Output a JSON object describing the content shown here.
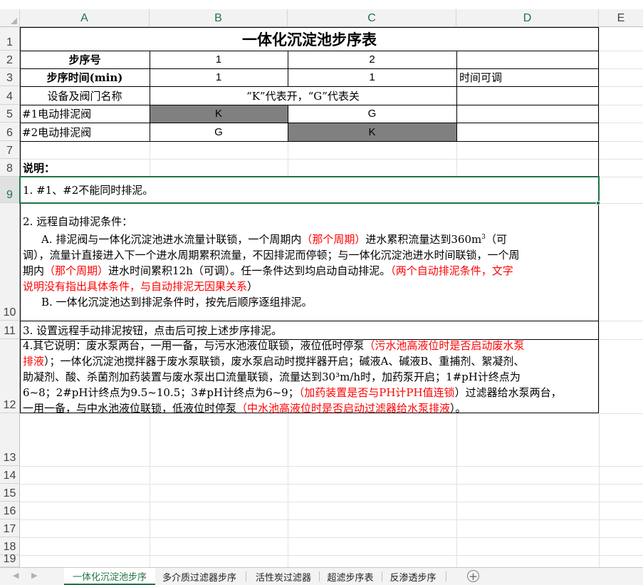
{
  "columns": [
    "A",
    "B",
    "C",
    "D",
    "E"
  ],
  "rows": [
    "1",
    "2",
    "3",
    "4",
    "5",
    "6",
    "7",
    "8",
    "9",
    "10",
    "11",
    "12",
    "13",
    "14",
    "15",
    "16",
    "17",
    "18",
    "19"
  ],
  "selected_row": "9",
  "sheet": {
    "title": "一体化沉淀池步序表",
    "row2": {
      "label": "步序号",
      "b": "1",
      "c": "2"
    },
    "row3": {
      "label": "步序时间(min)",
      "b": "1",
      "c": "1",
      "d": "时间可调"
    },
    "row4": {
      "label": "设备及阀门名称",
      "bc": "“K”代表开，“G”代表关"
    },
    "row5": {
      "label": "#1电动排泥阀",
      "b": "K",
      "c": "G"
    },
    "row6": {
      "label": "#2电动排泥阀",
      "b": "G",
      "c": "K"
    },
    "row8": {
      "label": "说明："
    },
    "row9": {
      "text": "1. #1、#2不能同时排泥。"
    },
    "row10": {
      "l1": "2. 远程自动排泥条件：",
      "l2_a": "A. 排泥阀与一体化沉淀池进水流量计联锁，一个周期内",
      "l2_r": "（那个周期）",
      "l2_b": "进水累积流量达到360m",
      "l2_sup": "3",
      "l2_c": "（可",
      "l3": "调），流量计直接进入下一个进水周期累积流量，不因排泥而停顿；与一体化沉淀池进水时间联锁，一个周",
      "l4_a": "期内",
      "l4_r1": "（那个周期）",
      "l4_b": "进水时间累积12h（可调）。任一条件达到均启动自动排泥。",
      "l4_r2": "（两个自动排泥条件，文字",
      "l5_r": "说明没有指出具体条件，与自动排泥无因果关系",
      "l5_b": "）",
      "l6": "B. 一体化沉淀池达到排泥条件时，按先后顺序逐组排泥。"
    },
    "row11": {
      "text": "3. 设置远程手动排泥按钮，点击后可按上述步序排泥。"
    },
    "row12": {
      "l1_a": "4.其它说明：废水泵两台，一用一备，与污水池液位联锁，液位低时停泵",
      "l1_r": "（污水池高液位时是否启动废水泵",
      "l2_r": "排液",
      "l2_b": "）；一体化沉淀池搅拌器于废水泵联锁，废水泵启动时搅拌器开启；碱液A、碱液B、重捕剂、絮凝剂、",
      "l3": "助凝剂、酸、杀菌剂加药装置与废水泵出口流量联锁，流量达到30³m/h时，加药泵开启；1#pH计终点为",
      "l4_a": "6~8；2#pH计终点为9.5~10.5；3#pH计终点为6~9；",
      "l4_r": "（加药装置是否与PH计PH值连锁",
      "l4_b": "）过滤器给水泵两台，",
      "l5_a": "一用一备，与中水池液位联锁，低液位时停泵",
      "l5_r": "（中水池高液位时是否启动过滤器给水泵排液",
      "l5_b": "）。"
    }
  },
  "tabs": [
    "一体化沉淀池步序",
    "多介质过滤器步序",
    "活性炭过滤器",
    "超滤步序表",
    "反渗透步序"
  ],
  "active_tab": 0,
  "colors": {
    "accent": "#217346",
    "fill": "#808080",
    "note_red": "#ff0000"
  }
}
